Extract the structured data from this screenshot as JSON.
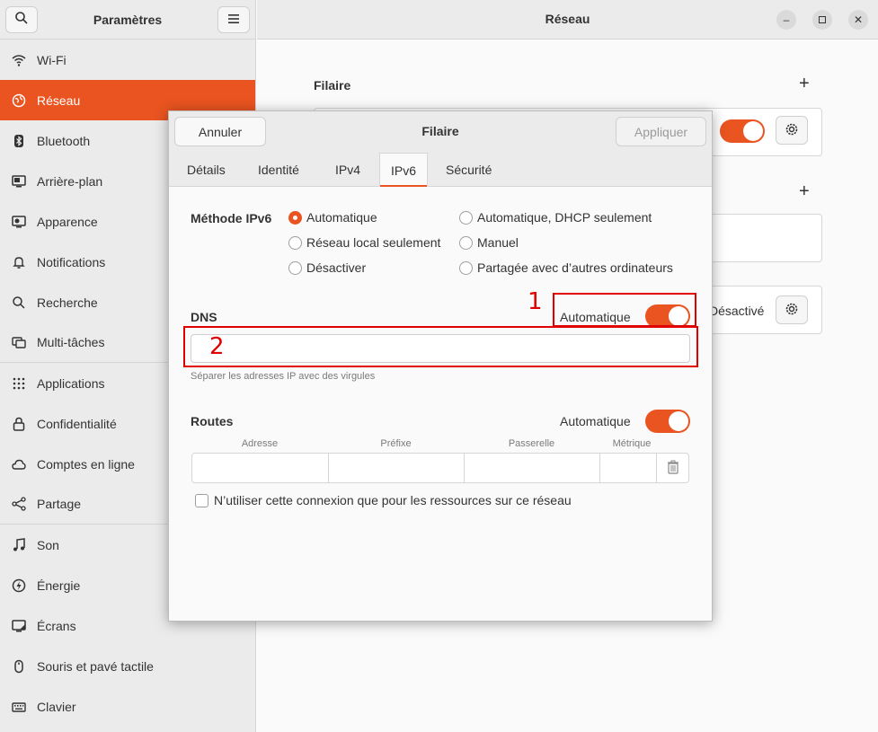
{
  "sidebar": {
    "title": "Paramètres",
    "items": [
      {
        "label": "Wi-Fi",
        "icon": "wifi-icon"
      },
      {
        "label": "Réseau",
        "icon": "network-icon"
      },
      {
        "label": "Bluetooth",
        "icon": "bluetooth-icon"
      },
      {
        "label": "Arrière-plan",
        "icon": "background-icon"
      },
      {
        "label": "Apparence",
        "icon": "appearance-icon"
      },
      {
        "label": "Notifications",
        "icon": "bell-icon"
      },
      {
        "label": "Recherche",
        "icon": "search-icon"
      },
      {
        "label": "Multi-tâches",
        "icon": "multitask-icon"
      },
      {
        "label": "Applications",
        "icon": "apps-grid-icon"
      },
      {
        "label": "Confidentialité",
        "icon": "lock-icon"
      },
      {
        "label": "Comptes en ligne",
        "icon": "cloud-icon"
      },
      {
        "label": "Partage",
        "icon": "share-icon"
      },
      {
        "label": "Son",
        "icon": "music-note-icon"
      },
      {
        "label": "Énergie",
        "icon": "power-icon"
      },
      {
        "label": "Écrans",
        "icon": "display-icon"
      },
      {
        "label": "Souris et pavé tactile",
        "icon": "mouse-icon"
      },
      {
        "label": "Clavier",
        "icon": "keyboard-icon"
      }
    ]
  },
  "main": {
    "title": "Réseau",
    "wired_section": "Filaire",
    "vpn_status": "Désactivé"
  },
  "dialog": {
    "cancel": "Annuler",
    "title": "Filaire",
    "apply": "Appliquer",
    "tabs": [
      "Détails",
      "Identité",
      "IPv4",
      "IPv6",
      "Sécurité"
    ],
    "active_tab": "IPv6",
    "method_label": "Méthode IPv6",
    "methods": [
      {
        "label": "Automatique",
        "selected": true
      },
      {
        "label": "Automatique, DHCP seulement",
        "selected": false
      },
      {
        "label": "Réseau local seulement",
        "selected": false
      },
      {
        "label": "Manuel",
        "selected": false
      },
      {
        "label": "Désactiver",
        "selected": false
      },
      {
        "label": "Partagée avec d’autres ordinateurs",
        "selected": false
      }
    ],
    "dns_label": "DNS",
    "dns_auto_label": "Automatique",
    "dns_value": "",
    "dns_hint": "Séparer les adresses IP avec des virgules",
    "routes_label": "Routes",
    "routes_auto_label": "Automatique",
    "route_columns": [
      "Adresse",
      "Préfixe",
      "Passerelle",
      "Métrique"
    ],
    "only_local_checkbox": "N’utiliser cette connexion que pour les ressources sur ce réseau"
  },
  "annotations": [
    "1",
    "2"
  ],
  "colors": {
    "accent": "#e95420",
    "annotation": "#e00000"
  }
}
